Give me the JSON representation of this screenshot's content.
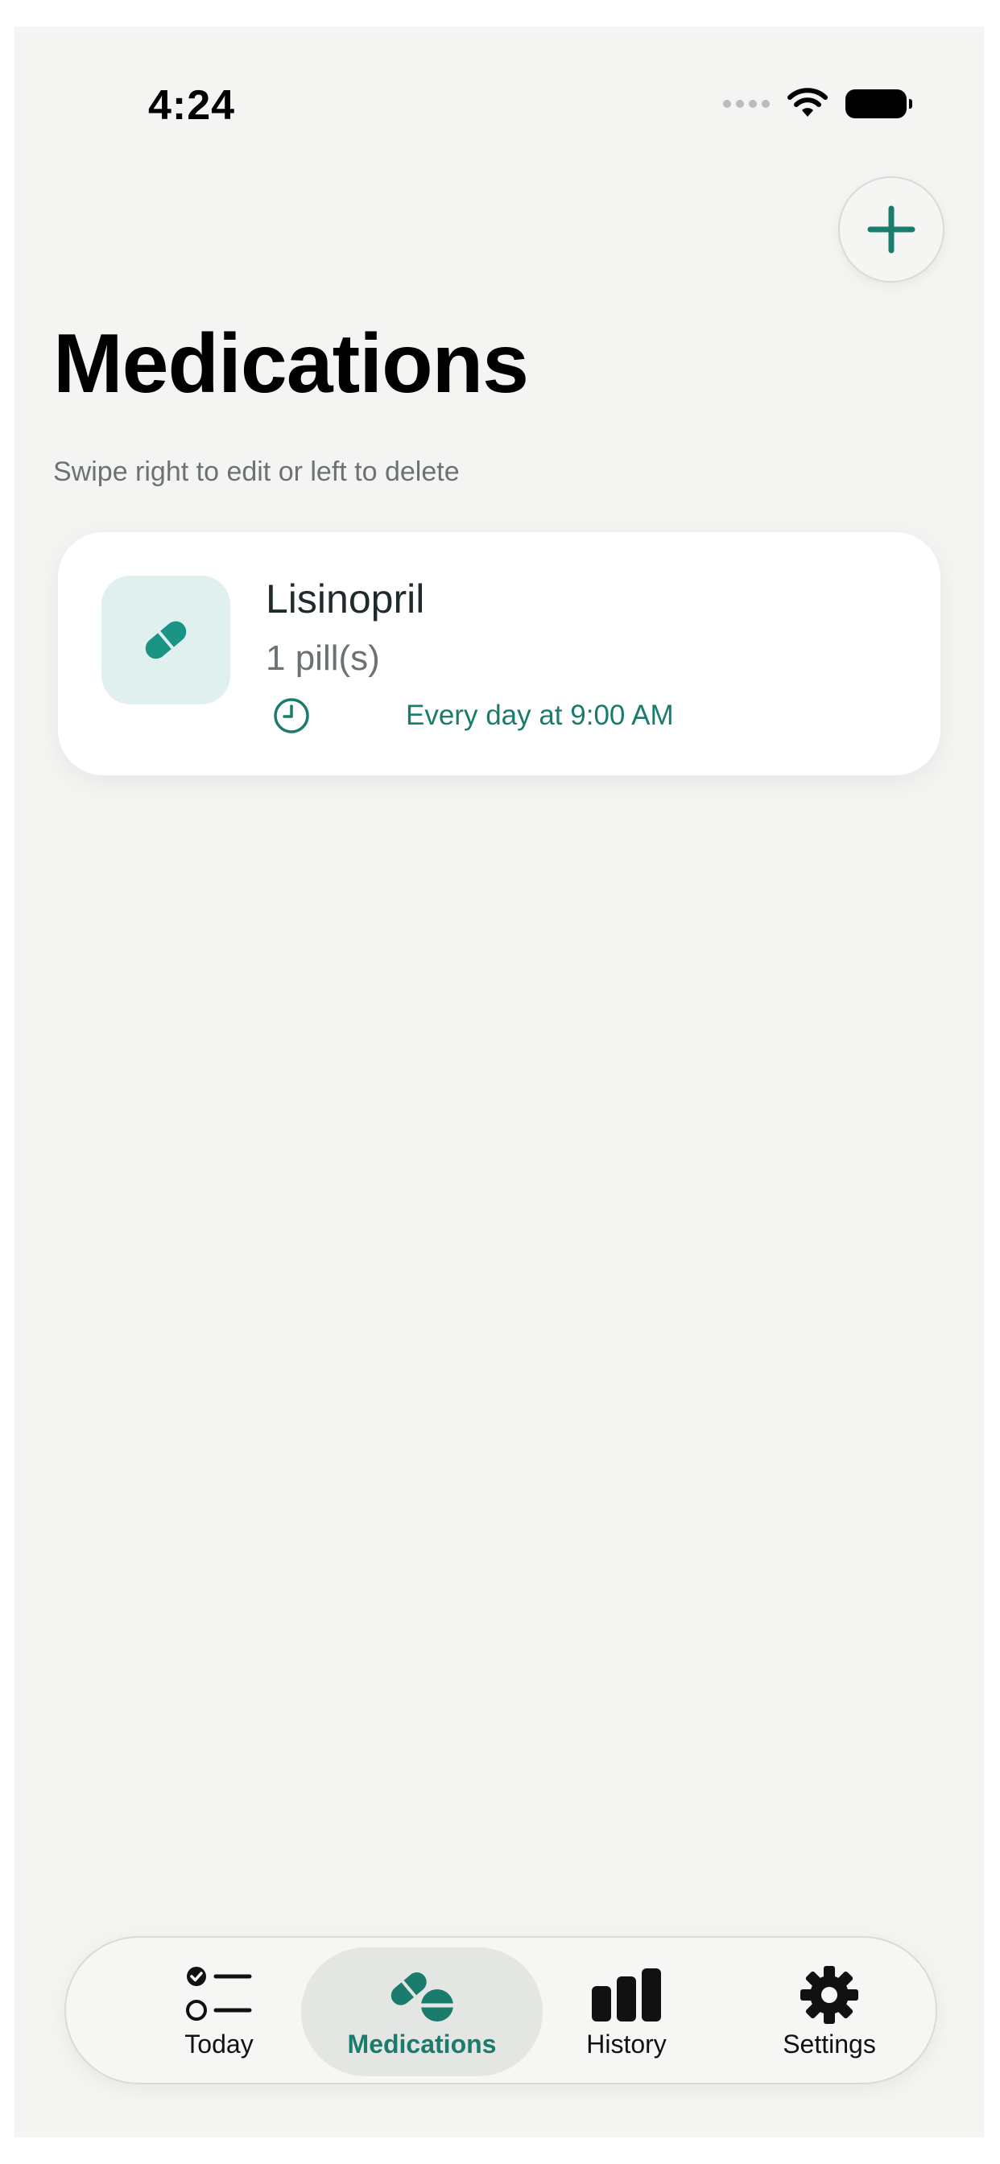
{
  "status_bar": {
    "time": "4:24"
  },
  "header": {
    "title": "Medications",
    "hint": "Swipe right to edit or left to delete",
    "add_icon": "plus-icon"
  },
  "medications": [
    {
      "name": "Lisinopril",
      "dose": "1 pill(s)",
      "schedule": "Every day at 9:00 AM",
      "icon": "pill-icon"
    }
  ],
  "tab_bar": {
    "tabs": [
      {
        "label": "Today",
        "icon": "checklist-icon",
        "active": false
      },
      {
        "label": "Medications",
        "icon": "pills-icon",
        "active": true
      },
      {
        "label": "History",
        "icon": "bar-chart-icon",
        "active": false
      },
      {
        "label": "Settings",
        "icon": "gear-icon",
        "active": false
      }
    ]
  },
  "colors": {
    "accent": "#1a7c6c",
    "background": "#f4f5f3",
    "card": "#ffffff",
    "icon_tile": "#dff0ee"
  }
}
